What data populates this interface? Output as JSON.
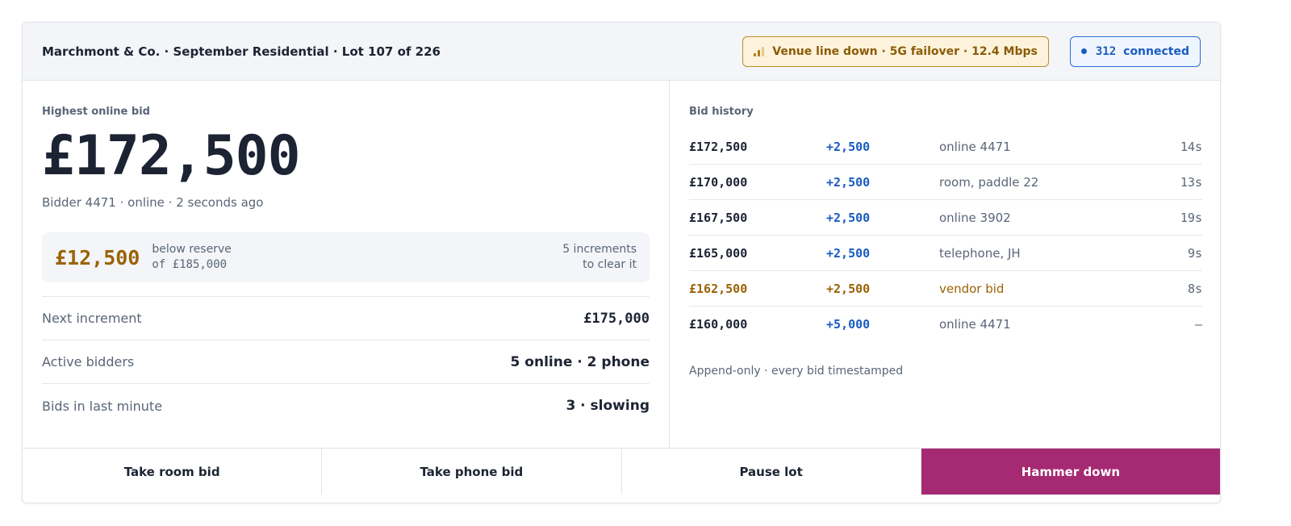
{
  "header": {
    "title": "Marchmont & Co. · September Residential · Lot 107 of 226",
    "network_badge": "Venue line down · 5G failover ·  12.4 Mbps",
    "network_icon": "signal-bars-icon",
    "connected_count": "312",
    "connected_label": "connected",
    "colors": {
      "warning": "#c08a2b",
      "info": "#2c6fd1"
    }
  },
  "highest": {
    "label": "Highest online bid",
    "amount": "£172,500",
    "bidder_line": "Bidder 4471 · online · 2 seconds ago"
  },
  "reserve": {
    "shortfall": "£12,500",
    "below_line1": "below reserve",
    "below_line2": "of £185,000",
    "increments_line1": "5 increments",
    "increments_line2": "to clear it"
  },
  "stats": [
    {
      "label": "Next increment",
      "value": "£175,000"
    },
    {
      "label": "Active bidders",
      "value": "5 online · 2 phone"
    },
    {
      "label": "Bids in last minute",
      "value": "3 · slowing"
    }
  ],
  "history": {
    "label": "Bid history",
    "rows": [
      {
        "amount": "£172,500",
        "increment": "+2,500",
        "source": "online 4471",
        "time": "14s"
      },
      {
        "amount": "£170,000",
        "increment": "+2,500",
        "source": "room, paddle 22",
        "time": "13s"
      },
      {
        "amount": "£167,500",
        "increment": "+2,500",
        "source": "online 3902",
        "time": "19s"
      },
      {
        "amount": "£165,000",
        "increment": "+2,500",
        "source": "telephone, JH",
        "time": "9s"
      },
      {
        "amount": "£162,500",
        "increment": "+2,500",
        "source": "vendor bid",
        "time": "8s"
      },
      {
        "amount": "£160,000",
        "increment": "+5,000",
        "source": "online 4471",
        "time": "—"
      }
    ],
    "footnote": "Append-only · every bid timestamped"
  },
  "actions": {
    "room": "Take room bid",
    "phone": "Take phone bid",
    "pause": "Pause lot",
    "hammer": "Hammer down",
    "hammer_color": "#a52a73"
  }
}
